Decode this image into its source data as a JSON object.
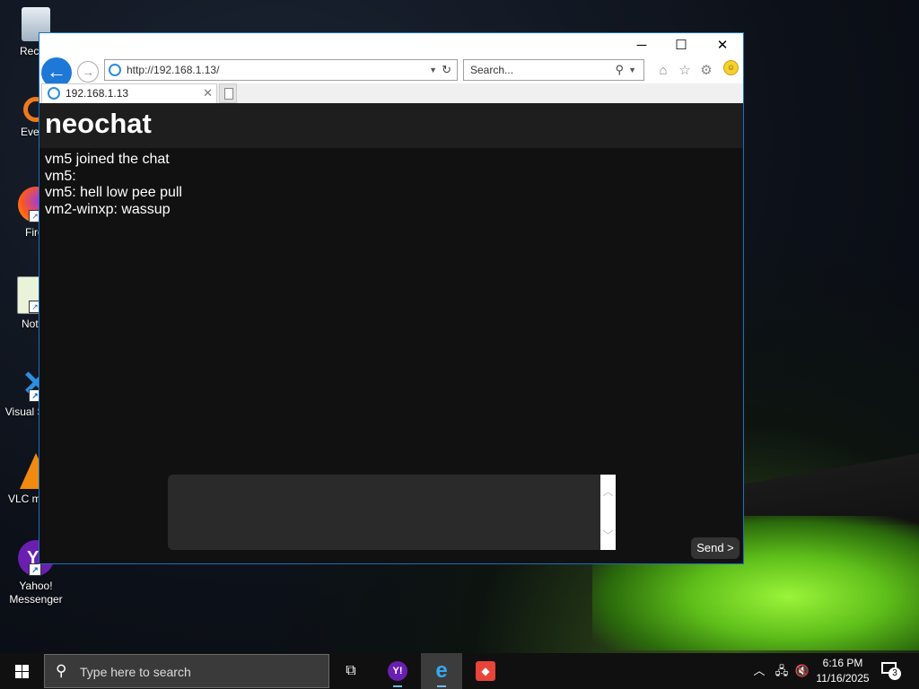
{
  "desktop": {
    "icons": [
      {
        "label": "Recycl",
        "icon": "recycle-bin-icon"
      },
      {
        "label": "Everyt",
        "icon": "everything-search-icon"
      },
      {
        "label": "Firef",
        "icon": "firefox-icon"
      },
      {
        "label": "Notep",
        "icon": "notepad-icon"
      },
      {
        "label": "Visual S Coc",
        "icon": "vscode-icon"
      },
      {
        "label": "VLC m play",
        "icon": "vlc-icon"
      },
      {
        "label": "Yahoo! Messenger",
        "icon": "yahoo-messenger-icon"
      }
    ]
  },
  "browser": {
    "window_controls": {
      "minimize": "─",
      "maximize": "☐",
      "close": "✕"
    },
    "address": "http://192.168.1.13/",
    "search_placeholder": "Search...",
    "tab_title": "192.168.1.13",
    "accent": "#1e78d7"
  },
  "app": {
    "title": "neochat",
    "messages": [
      "vm5 joined the chat",
      "vm5:",
      "vm5: hell low pee pull",
      "vm2-winxp: wassup"
    ],
    "send_label": "Send >"
  },
  "taskbar": {
    "search_placeholder": "Type here to search",
    "time": "6:16 PM",
    "date": "11/16/2025",
    "notification_count": "3"
  }
}
